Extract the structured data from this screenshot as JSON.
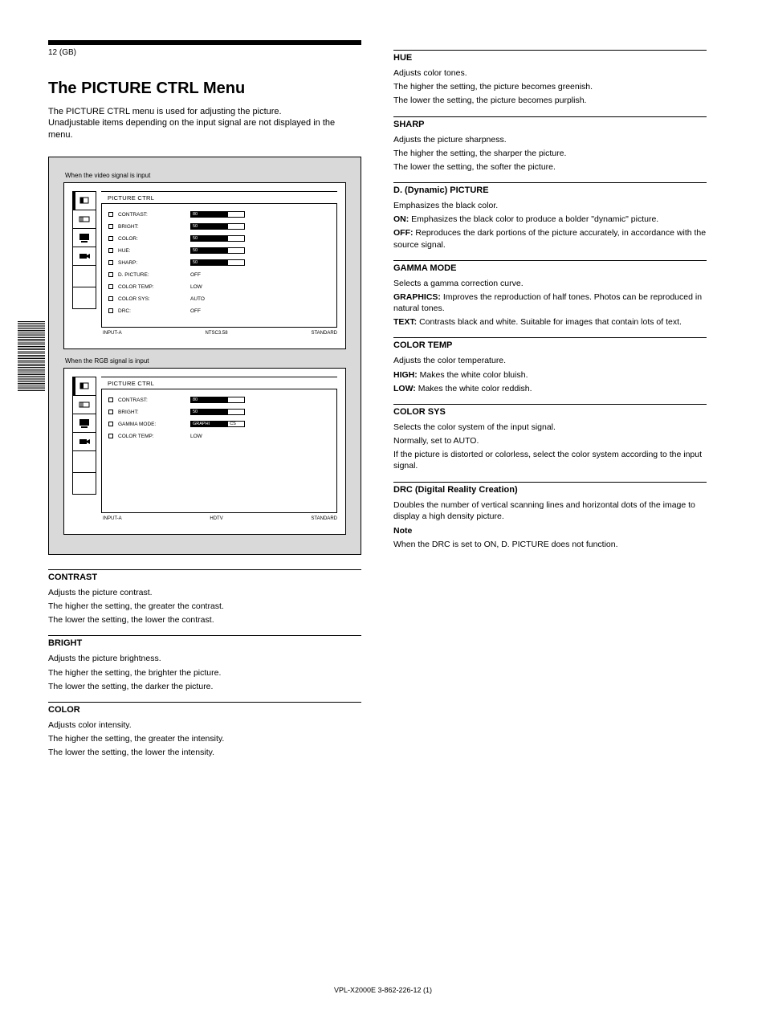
{
  "page_number": "12 (GB)",
  "title": "The PICTURE CTRL Menu",
  "subtitle": "The PICTURE CTRL menu is used for adjusting the picture.\nUnadjustable items depending on the input signal are not displayed in the menu.",
  "screen_note1": "When the video signal is input",
  "screen_note2": "When the RGB signal is input",
  "screen1": {
    "title": "PICTURE CTRL",
    "items": [
      {
        "label": "CONTRAST:",
        "fill": "80",
        "rest": ""
      },
      {
        "label": "BRIGHT:",
        "fill": "50",
        "rest": ""
      },
      {
        "label": "COLOR:",
        "fill": "50",
        "rest": ""
      },
      {
        "label": "HUE:",
        "fill": "50",
        "rest": ""
      },
      {
        "label": "SHARP:",
        "fill": "50",
        "rest": ""
      },
      {
        "label": "D. PICTURE:",
        "plain": "OFF"
      },
      {
        "label": "COLOR TEMP:",
        "plain": "LOW"
      },
      {
        "label": "COLOR SYS:",
        "plain": "AUTO"
      },
      {
        "label": "DRC:",
        "plain": "OFF"
      }
    ],
    "foot_left": "INPUT-A",
    "foot_mid": "NTSC3.58",
    "foot_right": "STANDARD"
  },
  "screen2": {
    "title": "PICTURE CTRL",
    "items": [
      {
        "label": "CONTRAST:",
        "fill": "80",
        "rest": ""
      },
      {
        "label": "BRIGHT:",
        "fill": "50",
        "rest": ""
      },
      {
        "label": "GAMMA MODE:",
        "fill": "GRAPHI",
        "rest": "CS"
      },
      {
        "label": "COLOR TEMP:",
        "plain": "LOW"
      }
    ],
    "foot_left": "INPUT-A",
    "foot_mid": "HDTV",
    "foot_right": "STANDARD"
  },
  "sections_left": [
    {
      "hd": "CONTRAST",
      "body": [
        "Adjusts the picture contrast.",
        "The higher the setting, the greater the contrast.",
        "The lower the setting, the lower the contrast."
      ]
    },
    {
      "hd": "BRIGHT",
      "body": [
        "Adjusts the picture brightness.",
        "The higher the setting, the brighter the picture.",
        "The lower the setting, the darker the picture."
      ]
    },
    {
      "hd": "COLOR",
      "body": [
        "Adjusts color intensity.",
        "The higher the setting, the greater the intensity.",
        "The lower the setting, the lower the intensity."
      ]
    }
  ],
  "sections_right": [
    {
      "hd": "HUE",
      "body": [
        "Adjusts color tones.",
        "The higher the setting, the picture becomes greenish.",
        "The lower the setting, the picture becomes purplish."
      ]
    },
    {
      "hd": "SHARP",
      "body": [
        "Adjusts the picture sharpness.",
        "The higher the setting, the sharper the picture.",
        "The lower the setting, the softer the picture."
      ]
    },
    {
      "hd": "D. (Dynamic) PICTURE",
      "body": [
        "Emphasizes the black color.",
        "ON: Emphasizes the black color to produce a bolder \"dynamic\" picture.",
        "OFF: Reproduces the dark portions of the picture accurately, in accordance with the source signal."
      ]
    },
    {
      "hd": "GAMMA MODE",
      "body": [
        "Selects a gamma correction curve.",
        "GRAPHICS: Improves the reproduction of half tones. Photos can be reproduced in natural tones.",
        "TEXT: Contrasts black and white. Suitable for images that contain lots of text."
      ]
    },
    {
      "hd": "COLOR TEMP",
      "body": [
        "Adjusts the color temperature.",
        "HIGH: Makes the white color bluish.",
        "LOW: Makes the white color reddish."
      ]
    },
    {
      "hd": "COLOR SYS",
      "body": [
        "Selects the color system of the input signal.",
        "Normally, set to AUTO.",
        "If the picture is distorted or colorless, select the color system according to the input signal."
      ]
    },
    {
      "hd": "DRC (Digital Reality Creation)",
      "body": [
        "Doubles the number of vertical scanning lines and horizontal dots of the image to display a high density picture.",
        "Note",
        "When the DRC is set to ON, D. PICTURE does not function."
      ]
    }
  ],
  "footer": "VPL-X2000E   3-862-226-12 (1)"
}
